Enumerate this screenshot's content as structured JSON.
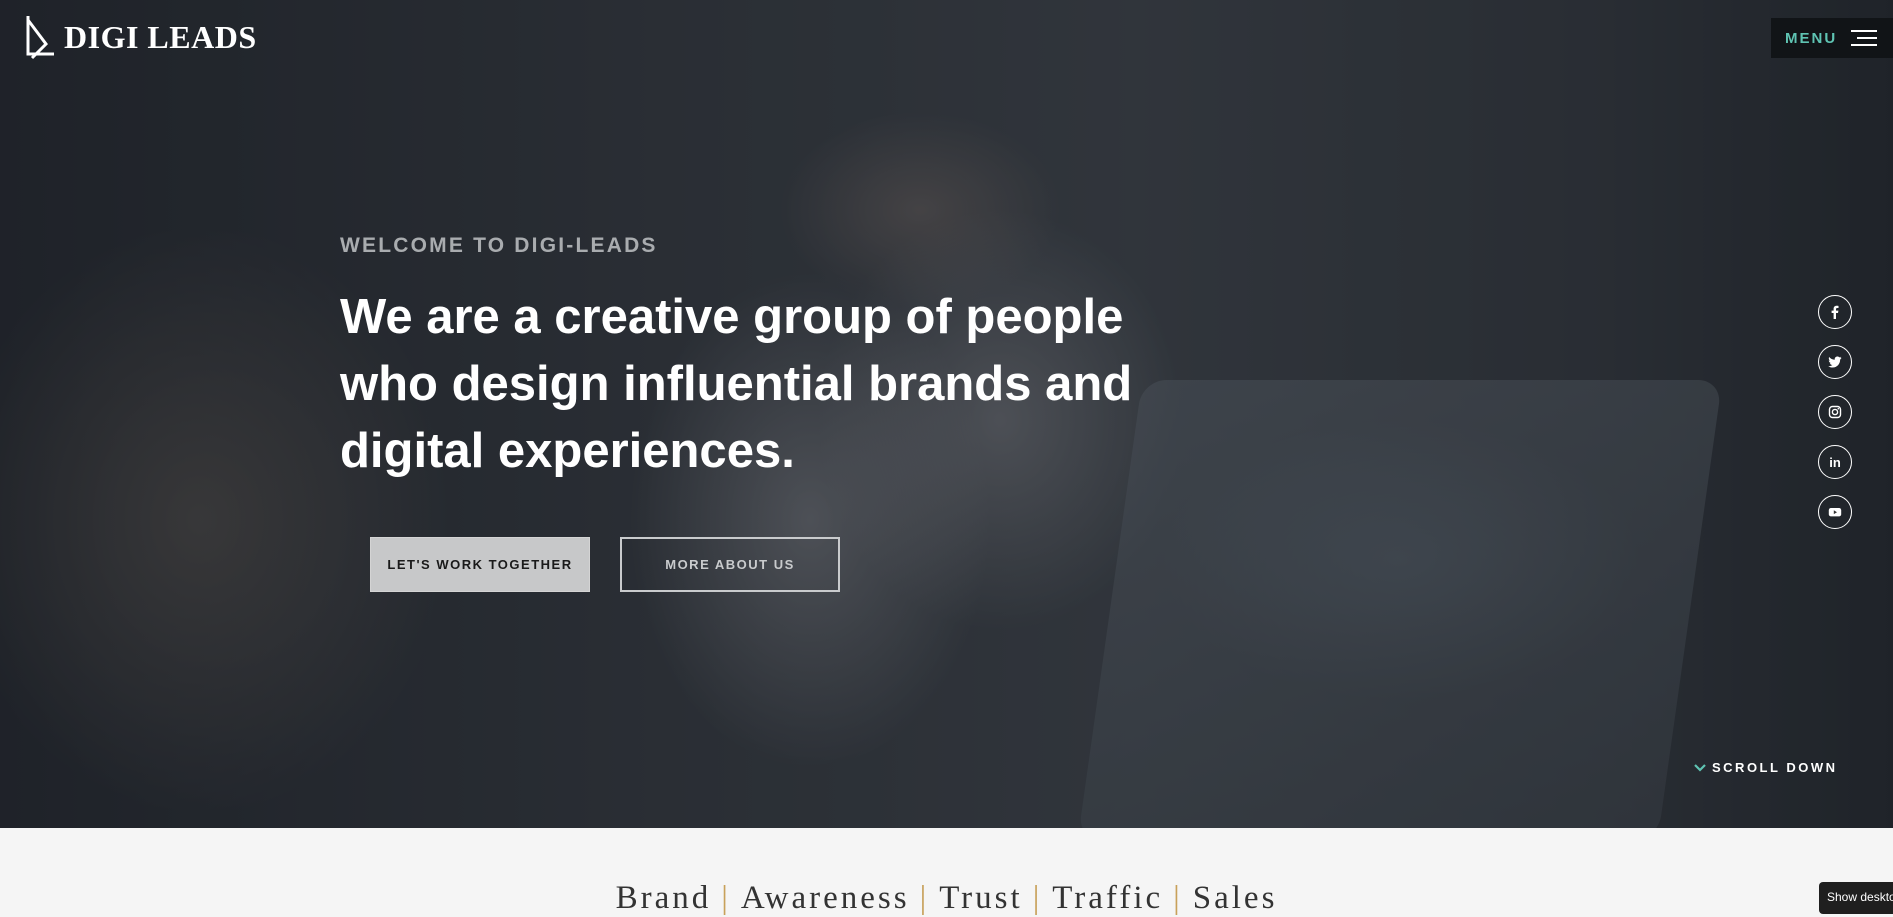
{
  "brand": {
    "name": "DIGI LEADS",
    "logo_icon": "logo-mark"
  },
  "menu": {
    "label": "MENU",
    "icon": "hamburger-icon"
  },
  "hero": {
    "welcome": "WELCOME TO DIGI-LEADS",
    "headline": "We are a creative group of people who design influential brands and digital experiences.",
    "primary_cta": "LET'S WORK TOGETHER",
    "secondary_cta": "MORE ABOUT US"
  },
  "socials": [
    {
      "name": "facebook",
      "icon": "facebook-icon"
    },
    {
      "name": "twitter",
      "icon": "twitter-icon"
    },
    {
      "name": "instagram",
      "icon": "instagram-icon"
    },
    {
      "name": "linkedin",
      "icon": "linkedin-icon",
      "text": "in"
    },
    {
      "name": "youtube",
      "icon": "youtube-icon"
    }
  ],
  "scroll": {
    "label": "SCROLL DOWN",
    "icon": "chevron-down-icon"
  },
  "tagline": {
    "items": [
      "Brand",
      "Awareness",
      "Trust",
      "Traffic",
      "Sales"
    ],
    "separator": "|"
  },
  "tooltip": {
    "text": "Show deskto"
  },
  "colors": {
    "accent": "#5fc4b3",
    "separator": "#c8a15a",
    "menu_bg": "#111417"
  }
}
